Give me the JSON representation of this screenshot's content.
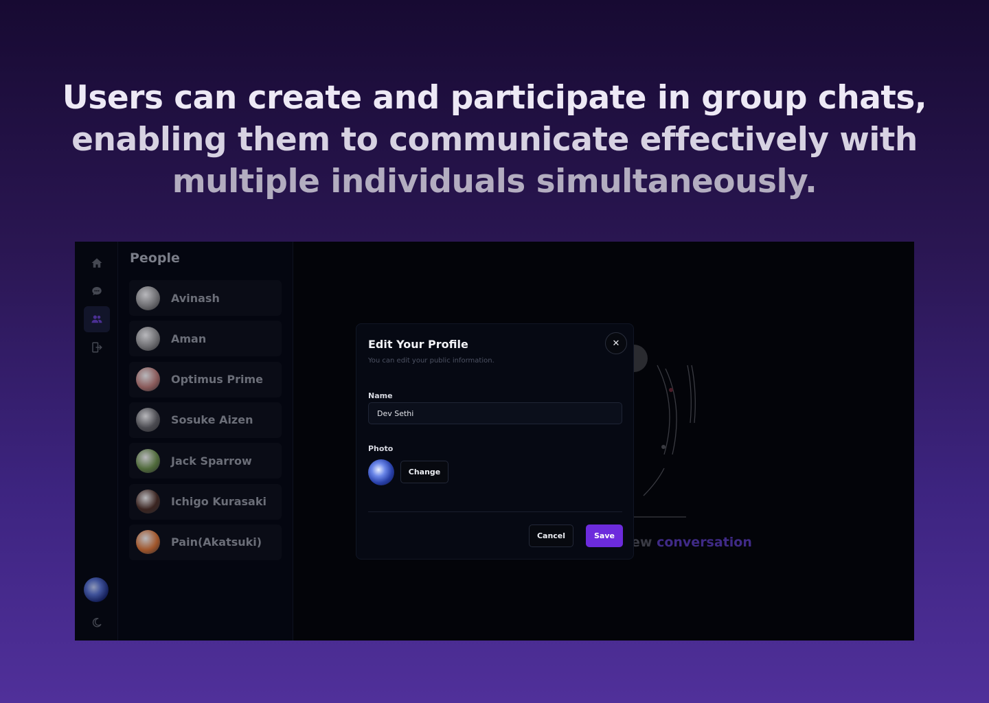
{
  "headline": {
    "line1": "Users can create and participate in group chats,",
    "line2": "enabling them to communicate effectively with",
    "line3": "multiple individuals simultaneously."
  },
  "rail": {
    "icons": [
      "home-icon",
      "chat-icon",
      "users-icon",
      "logout-icon"
    ],
    "active": "users-icon",
    "bottom_icons": [
      "avatar",
      "moon-icon"
    ]
  },
  "people": {
    "title": "People",
    "items": [
      {
        "name": "Avinash",
        "avatar_color": "#6c6c70"
      },
      {
        "name": "Aman",
        "avatar_color": "#6c6c70"
      },
      {
        "name": "Optimus Prime",
        "avatar_color": "#8a5a5a"
      },
      {
        "name": "Sosuke Aizen",
        "avatar_color": "#4a4a50"
      },
      {
        "name": "Jack Sparrow",
        "avatar_color": "#4f6a3a"
      },
      {
        "name": "Ichigo Kurasaki",
        "avatar_color": "#3a2420"
      },
      {
        "name": "Pain(Akatsuki)",
        "avatar_color": "#a0552a"
      }
    ]
  },
  "background_text": {
    "prefix": "ew",
    "accent": "conversation"
  },
  "modal": {
    "title": "Edit Your Profile",
    "subtitle": "You can edit your public information.",
    "name_label": "Name",
    "name_value": "Dev Sethi",
    "photo_label": "Photo",
    "change_label": "Change",
    "cancel_label": "Cancel",
    "save_label": "Save",
    "close_symbol": "✕"
  },
  "colors": {
    "accent": "#6c2bdc",
    "background": "#030409"
  }
}
